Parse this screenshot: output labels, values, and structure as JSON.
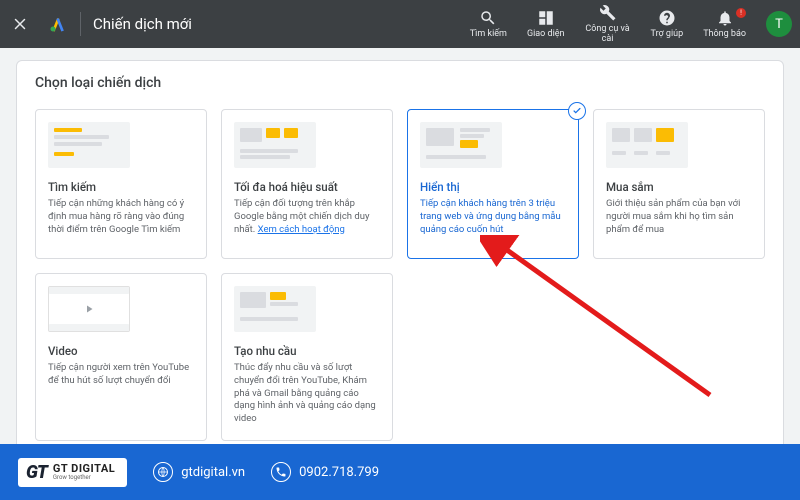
{
  "header": {
    "title": "Chiến dịch mới",
    "nav": {
      "search": "Tìm kiếm",
      "appearance": "Giao diện",
      "tools": "Công cụ và cài",
      "help": "Trợ giúp",
      "notifications": "Thông báo"
    },
    "avatar_initial": "T"
  },
  "panel": {
    "title": "Chọn loại chiến dịch"
  },
  "cards": {
    "search": {
      "title": "Tìm kiếm",
      "desc": "Tiếp cận những khách hàng có ý định mua hàng rõ ràng vào đúng thời điểm trên Google Tìm kiếm"
    },
    "pmax": {
      "title": "Tối đa hoá hiệu suất",
      "desc_a": "Tiếp cận đối tượng trên khắp Google bằng một chiến dịch duy nhất. ",
      "link": "Xem cách hoạt động"
    },
    "display": {
      "title": "Hiển thị",
      "desc": "Tiếp cận khách hàng trên 3 triệu trang web và ứng dụng bằng mẫu quảng cáo cuốn hút"
    },
    "shopping": {
      "title": "Mua sắm",
      "desc": "Giới thiệu sản phẩm của bạn với người mua sắm khi họ tìm sản phẩm để mua"
    },
    "video": {
      "title": "Video",
      "desc": "Tiếp cận người xem trên YouTube để thu hút số lượt chuyển đổi"
    },
    "demand": {
      "title": "Tạo nhu cầu",
      "desc": "Thúc đẩy nhu cầu và số lượt chuyển đổi trên YouTube, Khám phá và Gmail bằng quảng cáo dạng hình ảnh và quảng cáo dạng video"
    }
  },
  "footer": {
    "brand_name": "GT DIGITAL",
    "brand_tag": "Grow together",
    "website": "gtdigital.vn",
    "phone": "0902.718.799"
  }
}
